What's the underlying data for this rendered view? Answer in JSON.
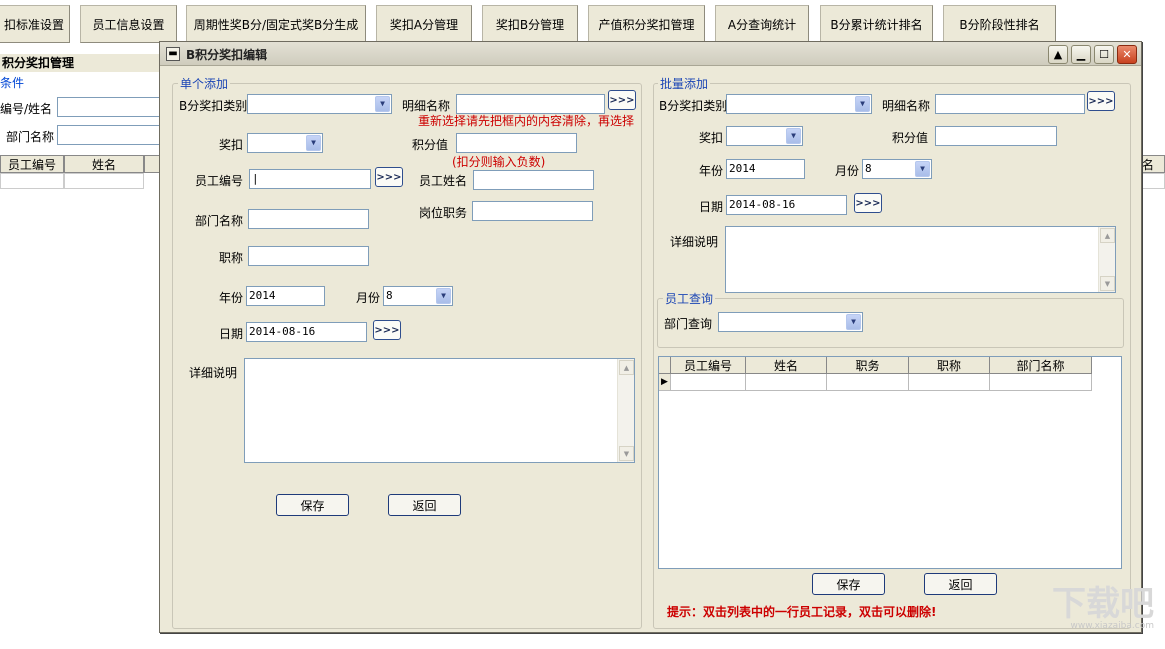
{
  "toolbar": {
    "items": [
      "扣标准设置",
      "员工信息设置",
      "周期性奖B分/固定式奖B分生成",
      "奖扣A分管理",
      "奖扣B分管理",
      "产值积分奖扣管理",
      "A分查询统计",
      "B分累计统计排名",
      "B分阶段性排名"
    ]
  },
  "background_form": {
    "title": "积分奖扣管理",
    "conditions": "条件",
    "id_name_label": "编号/姓名",
    "dept_label": "部门名称",
    "grid_headers": [
      "员工编号",
      "姓名"
    ],
    "right_header": "门名称"
  },
  "dialog": {
    "title": "B积分奖扣编辑",
    "single": {
      "group_title": "单个添加",
      "category_label": "B分奖扣类别",
      "detail_label": "明细名称",
      "reselect_hint": "重新选择请先把框内的内容清除，再选择",
      "reward_label": "奖扣",
      "score_label": "积分值",
      "deduct_hint": "(扣分则输入负数)",
      "emp_id_label": "员工编号",
      "emp_id_value": "|",
      "emp_name_label": "员工姓名",
      "dept_label": "部门名称",
      "post_label": "岗位职务",
      "title_label": "职称",
      "year_label": "年份",
      "year_value": "2014",
      "month_label": "月份",
      "month_value": "8",
      "date_label": "日期",
      "date_value": "2014-08-16",
      "desc_label": "详细说明",
      "save": "保存",
      "back": "返回"
    },
    "batch": {
      "group_title": "批量添加",
      "category_label": "B分奖扣类别",
      "detail_label": "明细名称",
      "reward_label": "奖扣",
      "score_label": "积分值",
      "year_label": "年份",
      "year_value": "2014",
      "month_label": "月份",
      "month_value": "8",
      "date_label": "日期",
      "date_value": "2014-08-16",
      "desc_label": "详细说明",
      "emp_query_title": "员工查询",
      "dept_query_label": "部门查询",
      "grid_headers": [
        "员工编号",
        "姓名",
        "职务",
        "职称",
        "部门名称"
      ],
      "save": "保存",
      "back": "返回",
      "tip": "提示：双击列表中的一行员工记录，双击可以删除!"
    },
    "pick_label": ">>>"
  },
  "watermark": {
    "main": "下载吧",
    "sub": "www.xiazaiba.com"
  },
  "colors": {
    "dialog_bg": "#ece9d8",
    "group_title": "#1c46b5",
    "hint_red": "#cc0000"
  }
}
